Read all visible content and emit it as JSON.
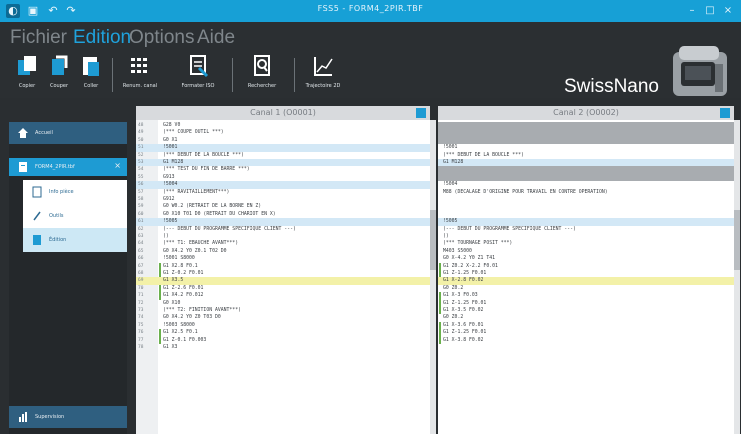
{
  "titlebar": {
    "title": "FSS5 - FORM4_2PIR.TBF",
    "minimize": "–",
    "maximize": "□",
    "close": "×"
  },
  "menu": {
    "items": [
      "Fichier",
      "Edition",
      "Options",
      "Aide"
    ],
    "active": "Edition"
  },
  "ribbon": {
    "buttons": [
      {
        "label": "Copier",
        "icon": "copy-icon"
      },
      {
        "label": "Couper",
        "icon": "cut-icon"
      },
      {
        "label": "Coller",
        "icon": "paste-icon"
      },
      {
        "label": "Renum. canal",
        "icon": "renumber-icon"
      },
      {
        "label": "Formater ISO",
        "icon": "format-iso-icon"
      },
      {
        "label": "Rechercher",
        "icon": "search-icon"
      },
      {
        "label": "Trajectoire 2D",
        "icon": "trajectory-icon"
      }
    ]
  },
  "brand": {
    "name": "SwissNano"
  },
  "sidebar": {
    "home": "Accueil",
    "file": "FORM4_2PIR.tbf",
    "subitems": [
      "Info pièce",
      "Outils",
      "Édition"
    ],
    "selected_sub": 2,
    "bottom": "Supervision"
  },
  "canal1": {
    "title": "Canal 1 (O0001)"
  },
  "canal2": {
    "title": "Canal 2 (O0002)"
  },
  "left_code": [
    {
      "n": "48",
      "t": "G28 V0",
      "hl": "none"
    },
    {
      "n": "49",
      "t": "(*** COUPE OUTIL ***)",
      "hl": "none"
    },
    {
      "n": "50",
      "t": "G0 X1",
      "hl": "none"
    },
    {
      "n": "51",
      "t": "!5001",
      "hl": "blue"
    },
    {
      "n": "52",
      "t": "(*** DEBUT DE LA BOUCLE ***)",
      "hl": "none"
    },
    {
      "n": "53",
      "t": "G1 M128",
      "hl": "blue"
    },
    {
      "n": "54",
      "t": "(*** TEST DU FIN DE BARRE ***)",
      "hl": "none"
    },
    {
      "n": "55",
      "t": "G913",
      "hl": "none"
    },
    {
      "n": "56",
      "t": "!5004",
      "hl": "blue"
    },
    {
      "n": "57",
      "t": "(*** RAVITAILLEMENT***)",
      "hl": "none"
    },
    {
      "n": "58",
      "t": "G912",
      "hl": "none"
    },
    {
      "n": "59",
      "t": "G0 W0.2 (RETRAIT DE LA BORNE EN Z)",
      "hl": "none"
    },
    {
      "n": "60",
      "t": "G0 X10 T01 D0 (RETRAIT DU CHARIOT EN X)",
      "hl": "none"
    },
    {
      "n": "61",
      "t": "!5005",
      "hl": "blue"
    },
    {
      "n": "62",
      "t": "(--- DEBUT DU PROGRAMME SPECIFIQUE CLIENT ---)",
      "hl": "none"
    },
    {
      "n": "63",
      "t": "()",
      "hl": "none"
    },
    {
      "n": "64",
      "t": "(*** T1: EBAUCHE AVANT***)",
      "hl": "none"
    },
    {
      "n": "65",
      "t": "G0 X4.2 Y0 Z0.1 T02 D0",
      "hl": "none"
    },
    {
      "n": "66",
      "t": "!5001 S8000",
      "hl": "none"
    },
    {
      "n": "67",
      "t": "G1 X2.8 F0.1",
      "hl": "green"
    },
    {
      "n": "68",
      "t": "G1 Z-0.2 F0.01",
      "hl": "green"
    },
    {
      "n": "69",
      "t": "G1 X3.5",
      "hl": "yellow"
    },
    {
      "n": "70",
      "t": "G1 Z-2.6 F0.01",
      "hl": "green"
    },
    {
      "n": "71",
      "t": "G1 X4.2 F0.012",
      "hl": "green"
    },
    {
      "n": "72",
      "t": "G0 X10",
      "hl": "none"
    },
    {
      "n": "73",
      "t": "(*** T2: FINITION AVANT***)",
      "hl": "none"
    },
    {
      "n": "74",
      "t": "G0 X4.2 Y0 Z0 T03 D0",
      "hl": "none"
    },
    {
      "n": "75",
      "t": "!5003 S8000",
      "hl": "none"
    },
    {
      "n": "76",
      "t": "G1 X2.5 F0.1",
      "hl": "green"
    },
    {
      "n": "77",
      "t": "G1 Z-0.1 F0.003",
      "hl": "green"
    },
    {
      "n": "78",
      "t": "G1 X3",
      "hl": "none"
    }
  ],
  "right_code": [
    {
      "t": "",
      "hl": "gray"
    },
    {
      "t": "",
      "hl": "gray"
    },
    {
      "t": "",
      "hl": "gray"
    },
    {
      "t": "!5001",
      "hl": "none"
    },
    {
      "t": "(*** DEBUT DE LA BOUCLE ***)",
      "hl": "none"
    },
    {
      "t": "G1 M128",
      "hl": "blue"
    },
    {
      "t": "",
      "hl": "gray"
    },
    {
      "t": "",
      "hl": "gray"
    },
    {
      "t": "!5004",
      "hl": "none"
    },
    {
      "t": "M88 (DECALAGE D'ORIGINE POUR TRAVAIL EN CONTRE OPERATION)",
      "hl": "none"
    },
    {
      "t": "",
      "hl": "none"
    },
    {
      "t": "",
      "hl": "none"
    },
    {
      "t": "",
      "hl": "none"
    },
    {
      "t": "!5005",
      "hl": "blue"
    },
    {
      "t": "(--- DEBUT DU PROGRAMME SPECIFIQUE CLIENT ---)",
      "hl": "none"
    },
    {
      "t": "()",
      "hl": "none"
    },
    {
      "t": "(*** TOURNAGE POSIT ***)",
      "hl": "none"
    },
    {
      "t": "M403 S5000",
      "hl": "none"
    },
    {
      "t": "G0 X-4.2 Y0 Z1 T41",
      "hl": "none"
    },
    {
      "t": "G1 Z0.2 X-2.2 F0.01",
      "hl": "green"
    },
    {
      "t": "G1 Z-1.25 F0.01",
      "hl": "green"
    },
    {
      "t": "G1 X-2.8 F0.02",
      "hl": "yellow"
    },
    {
      "t": "G0 Z0.2",
      "hl": "none"
    },
    {
      "t": "G1 X-3 F0.03",
      "hl": "green"
    },
    {
      "t": "G1 Z-1.25 F0.01",
      "hl": "green"
    },
    {
      "t": "G1 X-3.5 F0.02",
      "hl": "green"
    },
    {
      "t": "G0 Z0.2",
      "hl": "none"
    },
    {
      "t": "G1 X-3.6 F0.01",
      "hl": "green"
    },
    {
      "t": "G1 Z-1.25 F0.01",
      "hl": "green"
    },
    {
      "t": "G1 X-3.8 F0.02",
      "hl": "green"
    },
    {
      "t": "",
      "hl": "none"
    }
  ],
  "colors": {
    "accent": "#1e9bd3",
    "highlight_blue": "#d3e8f6",
    "highlight_yellow": "#f3f1a8",
    "highlight_gray": "#a8acb0",
    "diff_green": "#6ab04c"
  }
}
